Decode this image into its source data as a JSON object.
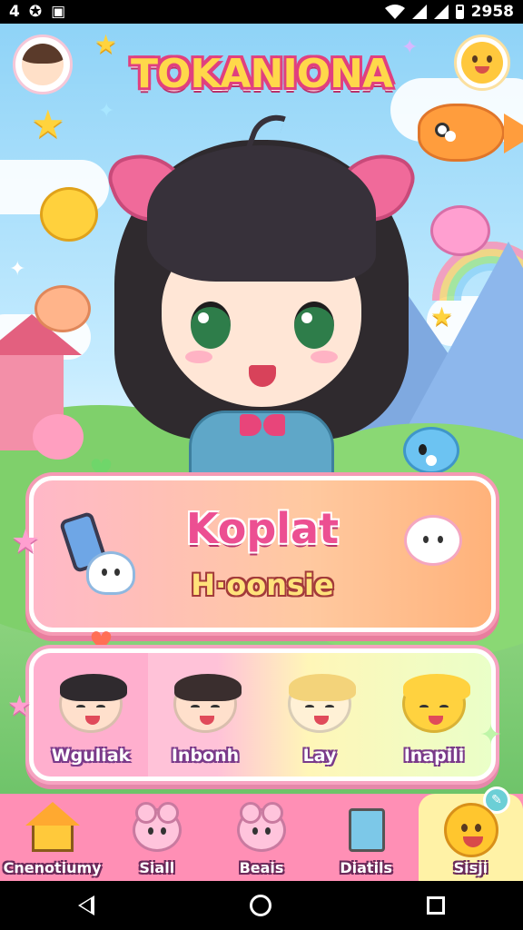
{
  "status_bar": {
    "left_icons": [
      "4",
      "notification-icon",
      "image-icon"
    ],
    "time": "2958"
  },
  "app": {
    "title": "TOKANIONA"
  },
  "feature_card": {
    "title": "Koplat",
    "subtitle": "H·oonsie"
  },
  "characters": [
    {
      "label": "Wguliak",
      "hair": "#2f2a2e",
      "skin": "#ffe0cc"
    },
    {
      "label": "Inbonh",
      "hair": "#3a2e2e",
      "skin": "#ffe0cc"
    },
    {
      "label": "Lay",
      "hair": "#f3d37a",
      "skin": "#fff1d6"
    },
    {
      "label": "Inapili",
      "hair": "#ffd23f",
      "skin": "#ffd23f"
    },
    {
      "label": "",
      "hair": "#a83a3a",
      "skin": "#ffe0cc"
    }
  ],
  "nav": [
    {
      "label": "Cnenotiumy",
      "icon": "home-icon"
    },
    {
      "label": "Siall",
      "icon": "bear-icon"
    },
    {
      "label": "Beais",
      "icon": "bear-icon"
    },
    {
      "label": "Diatils",
      "icon": "book-icon"
    },
    {
      "label": "Sisji",
      "icon": "smiley-icon",
      "active": true
    }
  ],
  "colors": {
    "brand_pink": "#ec4f92",
    "nav_bg": "#ff8fb5",
    "active_tab": "#fff2a6"
  }
}
